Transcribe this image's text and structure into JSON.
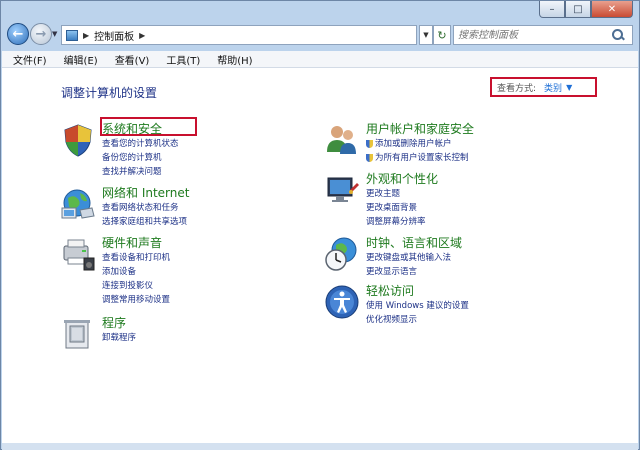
{
  "window": {
    "buttons": {
      "minimize": "–",
      "maximize": "□",
      "close": "✕"
    }
  },
  "nav": {
    "back_icon": "back-arrow-icon",
    "forward_icon": "forward-arrow-icon",
    "breadcrumb": "控制面板",
    "refresh_glyph": "↻",
    "search_placeholder": "搜索控制面板"
  },
  "menu": [
    "文件(F)",
    "编辑(E)",
    "查看(V)",
    "工具(T)",
    "帮助(H)"
  ],
  "content": {
    "title": "调整计算机的设置",
    "view_by_label": "查看方式:",
    "view_by_value": "类别",
    "categories": [
      {
        "title": "系统和安全",
        "icon": "system-security-icon",
        "links": [
          "查看您的计算机状态",
          "备份您的计算机",
          "查找并解决问题"
        ]
      },
      {
        "title": "网络和 Internet",
        "icon": "network-internet-icon",
        "links": [
          "查看网络状态和任务",
          "选择家庭组和共享选项"
        ]
      },
      {
        "title": "硬件和声音",
        "icon": "hardware-sound-icon",
        "links": [
          "查看设备和打印机",
          "添加设备",
          "连接到投影仪",
          "调整常用移动设置"
        ]
      },
      {
        "title": "程序",
        "icon": "programs-icon",
        "links": [
          "卸载程序"
        ]
      },
      {
        "title": "用户帐户和家庭安全",
        "icon": "user-accounts-icon",
        "links": [
          "添加或删除用户帐户",
          "为所有用户设置家长控制"
        ]
      },
      {
        "title": "外观和个性化",
        "icon": "appearance-icon",
        "links": [
          "更改主题",
          "更改桌面背景",
          "调整屏幕分辨率"
        ]
      },
      {
        "title": "时钟、语言和区域",
        "icon": "clock-language-icon",
        "links": [
          "更改键盘或其他输入法",
          "更改显示语言"
        ]
      },
      {
        "title": "轻松访问",
        "icon": "ease-of-access-icon",
        "links": [
          "使用 Windows 建议的设置",
          "优化视频显示"
        ]
      }
    ]
  },
  "colors": {
    "highlight_border": "#c8102e",
    "category_title": "#1e7a1e",
    "link": "#1e3287"
  }
}
